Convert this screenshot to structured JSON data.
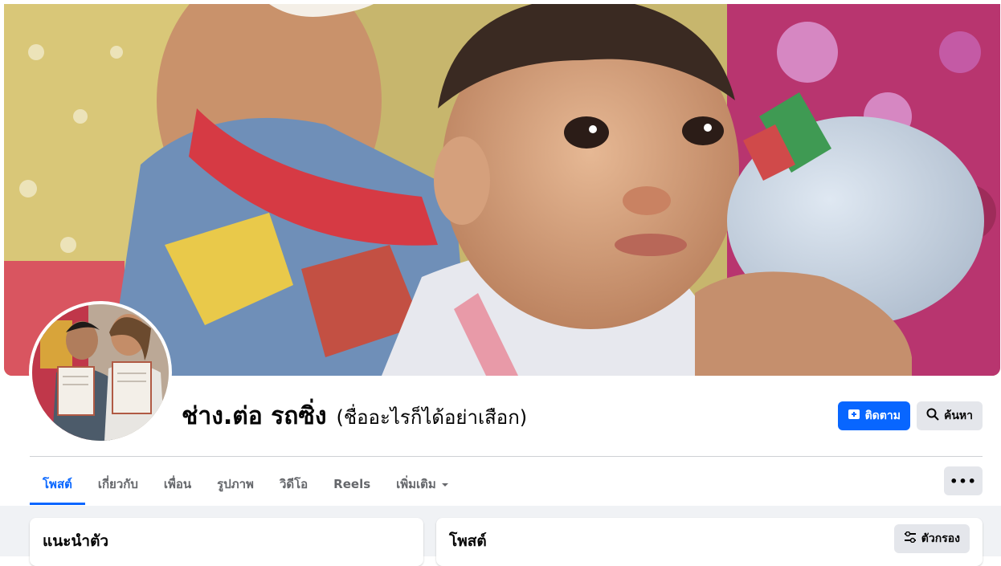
{
  "profile": {
    "name": "ช่าง.ต่อ รถซิ่ง",
    "alternate_name": "(ชื่ออะไรก็ได้อย่าเสือก)"
  },
  "actions": {
    "follow_label": "ติดตาม",
    "search_label": "ค้นหา"
  },
  "tabs": [
    {
      "label": "โพสต์",
      "active": true
    },
    {
      "label": "เกี่ยวกับ"
    },
    {
      "label": "เพื่อน"
    },
    {
      "label": "รูปภาพ"
    },
    {
      "label": "วิดีโอ"
    },
    {
      "label": "Reels"
    },
    {
      "label": "เพิ่มเติม"
    }
  ],
  "more_label": "•••",
  "intro_card": {
    "title": "แนะนำตัว"
  },
  "posts_card": {
    "title": "โพสต์",
    "filter_label": "ตัวกรอง"
  },
  "colors": {
    "accent": "#0866ff",
    "button_gray": "#e4e6eb",
    "feed_bg": "#f0f2f5"
  }
}
